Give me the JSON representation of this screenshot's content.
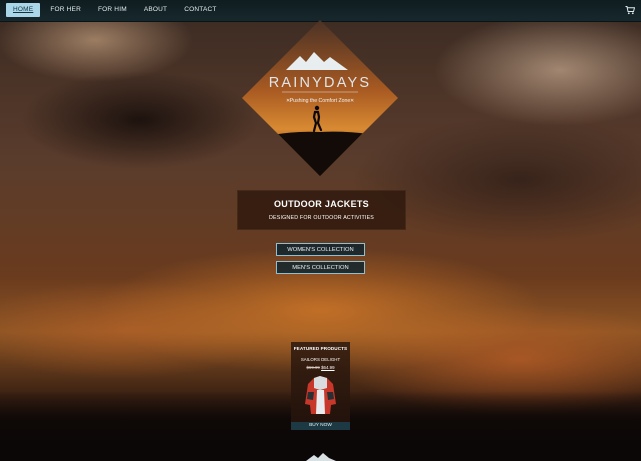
{
  "nav": {
    "links": [
      "HOME",
      "FOR HER",
      "FOR HIM",
      "ABOUT",
      "CONTACT"
    ],
    "active": "HOME",
    "cart_icon": "cart-icon"
  },
  "logo": {
    "brand": "RAINYDAYS",
    "tagline": "Pushing the Comfort Zone"
  },
  "hero": {
    "title": "OUTDOOR JACKETS",
    "subtitle": "DESIGNED FOR OUTDOOR ACTIVITIES"
  },
  "buttons": {
    "women": "WOMEN'S COLLECTION",
    "men": "MEN'S COLLECTION"
  },
  "featured": {
    "heading": "FEATURED PRODUCTS",
    "product_name": "SAILORS DELIGHT",
    "old_price": "$69.99",
    "new_price": "$64.99",
    "buy_label": "BUY NOW"
  },
  "colors": {
    "nav_bg": "#17282c",
    "active_tab": "#a9d6e8",
    "button_border": "#8fc0d2",
    "hero_bg": "#28140a"
  }
}
